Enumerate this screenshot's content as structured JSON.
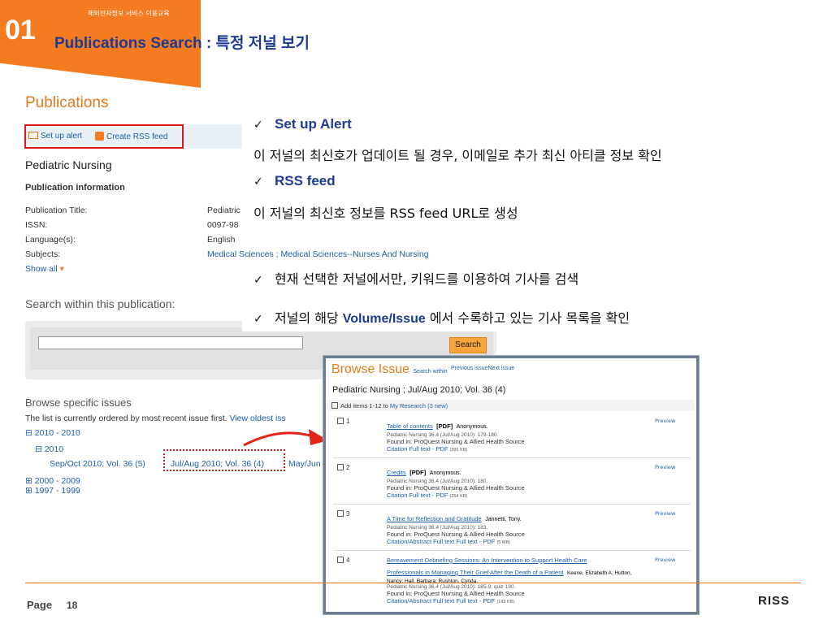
{
  "header": {
    "number": "01",
    "subtitle": "해외전자정보 서비스 이용교육",
    "title_en": "Publications Search",
    "title_sep": " : ",
    "title_ko": "특정 저널 보기"
  },
  "screenshot": {
    "heading": "Publications",
    "toolbar": {
      "alert_label": "Set up alert",
      "rss_label": "Create RSS feed"
    },
    "journal_name": "Pediatric Nursing",
    "pub_info_label": "Publication information",
    "fields": [
      {
        "label": "Publication Title:",
        "value": "Pediatric"
      },
      {
        "label": "ISSN:",
        "value": "0097-98"
      },
      {
        "label": "Language(s):",
        "value": "English"
      },
      {
        "label": "Subjects:",
        "value": "Medical Sciences ; Medical Sciences--Nurses And Nursing"
      }
    ],
    "show_all": "Show all",
    "search_within": "Search within this publication:",
    "search_button": "Search",
    "browse_heading": "Browse specific issues",
    "browse_text": "The list is currently ordered by most recent issue first.",
    "view_oldest": "View oldest iss",
    "tree": {
      "range1": "⊟ 2010 - 2010",
      "year": "⊟ 2010",
      "issue1": "Sep/Oct 2010; Vol. 36 (5)",
      "issue2": "Jul/Aug 2010; Vol. 36 (4)",
      "issue3": "May/Jun",
      "range2": "⊞ 2000 - 2009",
      "range3": "⊞ 1997 - 1999"
    }
  },
  "annotations": {
    "a1_title": "Set up Alert",
    "a1_text": "이 저널의 최신호가 업데이트 될 경우, 이메일로 추가 최신 아티클 정보 확인",
    "a2_title": "RSS feed",
    "a2_text": "이 저널의 최신호 정보를 RSS feed URL로 생성",
    "a3_text": "현재 선택한 저널에서만, 키워드를 이용하여 기사를 검색",
    "a4_pre": "저널의 해당 ",
    "a4_bold": "Volume/Issue",
    "a4_post": " 에서 수록하고 있는 기사 목록을 확인",
    "check": "✓"
  },
  "popup": {
    "heading": "Browse Issue",
    "search_within": "Search within",
    "prev_next": "Previous issueNext issue",
    "journal": "Pediatric Nursing ; Jul/Aug 2010; Vol. 36 (4)",
    "add_items": "Add items 1-12 to",
    "my_research": "My Research (3 new)",
    "preview": "Preview",
    "items": [
      {
        "num": "1",
        "title": "Table of contents",
        "tag": "[PDF]",
        "author": "Anonymous.",
        "meta": "Pediatric Nursing 36.4 (Jul/Aug 2010): 179-180.",
        "found": "Found in: ProQuest Nursing & Allied Health Source",
        "links": "Citation  Full text - PDF",
        "size": "(395 KB)"
      },
      {
        "num": "2",
        "title": "Credits",
        "tag": "[PDF]",
        "author": "Anonymous.",
        "meta": "Pediatric Nursing 36.4 (Jul/Aug 2010): 180.",
        "found": "Found in: ProQuest Nursing & Allied Health Source",
        "links": "Citation  Full text - PDF",
        "size": "(254 KB)"
      },
      {
        "num": "3",
        "title": "A Time for Reflection and Gratitude",
        "tag": "",
        "author": "Jannetti, Tony.",
        "meta": "Pediatric Nursing 36.4 (Jul/Aug 2010): 183.",
        "found": "Found in: ProQuest Nursing & Allied Health Source",
        "links": "Citation/Abstract  Full text  Full text - PDF",
        "size": "(5 MB)"
      },
      {
        "num": "4",
        "title": "Bereavement Debriefing Sessions: An Intervention to Support Health Care",
        "title2": "Professionals in Managing Their Grief After the Death of a Patient",
        "author": "Keene, Elizabeth A; Hutton,",
        "author2": "Nancy; Hall, Barbara; Rushton, Cynda.",
        "meta": "Pediatric Nursing 36.4 (Jul/Aug 2010): 185-9; quiz 190.",
        "found": "Found in: ProQuest Nursing & Allied Health Source",
        "links": "Citation/Abstract  Full text  Full text - PDF",
        "size": "(193 KB)"
      }
    ]
  },
  "footer": {
    "page_label": "Page",
    "page_number": "18",
    "logo": "RISS"
  }
}
